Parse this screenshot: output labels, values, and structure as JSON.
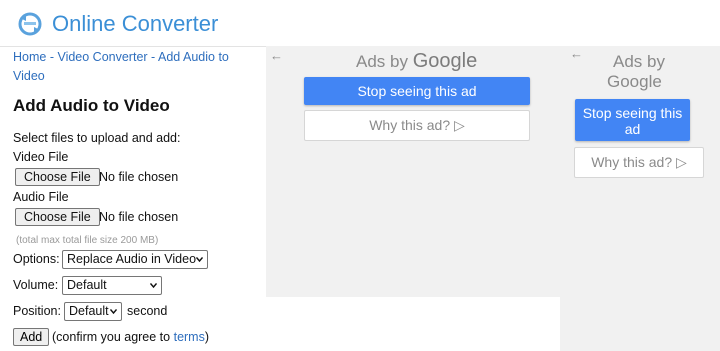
{
  "header": {
    "site_title": "Online Converter"
  },
  "breadcrumb": {
    "home": "Home",
    "sep1": " - ",
    "video_converter": "Video Converter",
    "sep2": " - ",
    "current": "Add Audio to Video"
  },
  "page": {
    "title": "Add Audio to Video",
    "intro": "Select files to upload and add:",
    "video_label": "Video File",
    "audio_label": "Audio File",
    "choose_file": "Choose File",
    "no_file": "No file chosen",
    "note": "(total max total file size 200 MB)",
    "options_label": "Options:",
    "options_value": "Replace Audio in Video",
    "volume_label": "Volume:",
    "volume_value": "Default",
    "position_label": "Position:",
    "position_value": "Default",
    "position_unit": "second",
    "add_button": "Add",
    "confirm_prefix": "(confirm you agree to ",
    "terms_link": "terms",
    "confirm_suffix": ")"
  },
  "ads": {
    "back_arrow": "←",
    "ads_by": "Ads by",
    "google": "Google",
    "stop_seeing": "Stop seeing this ad",
    "why_this_ad": "Why this ad? ▷",
    "google_blue": "#4285f4"
  }
}
